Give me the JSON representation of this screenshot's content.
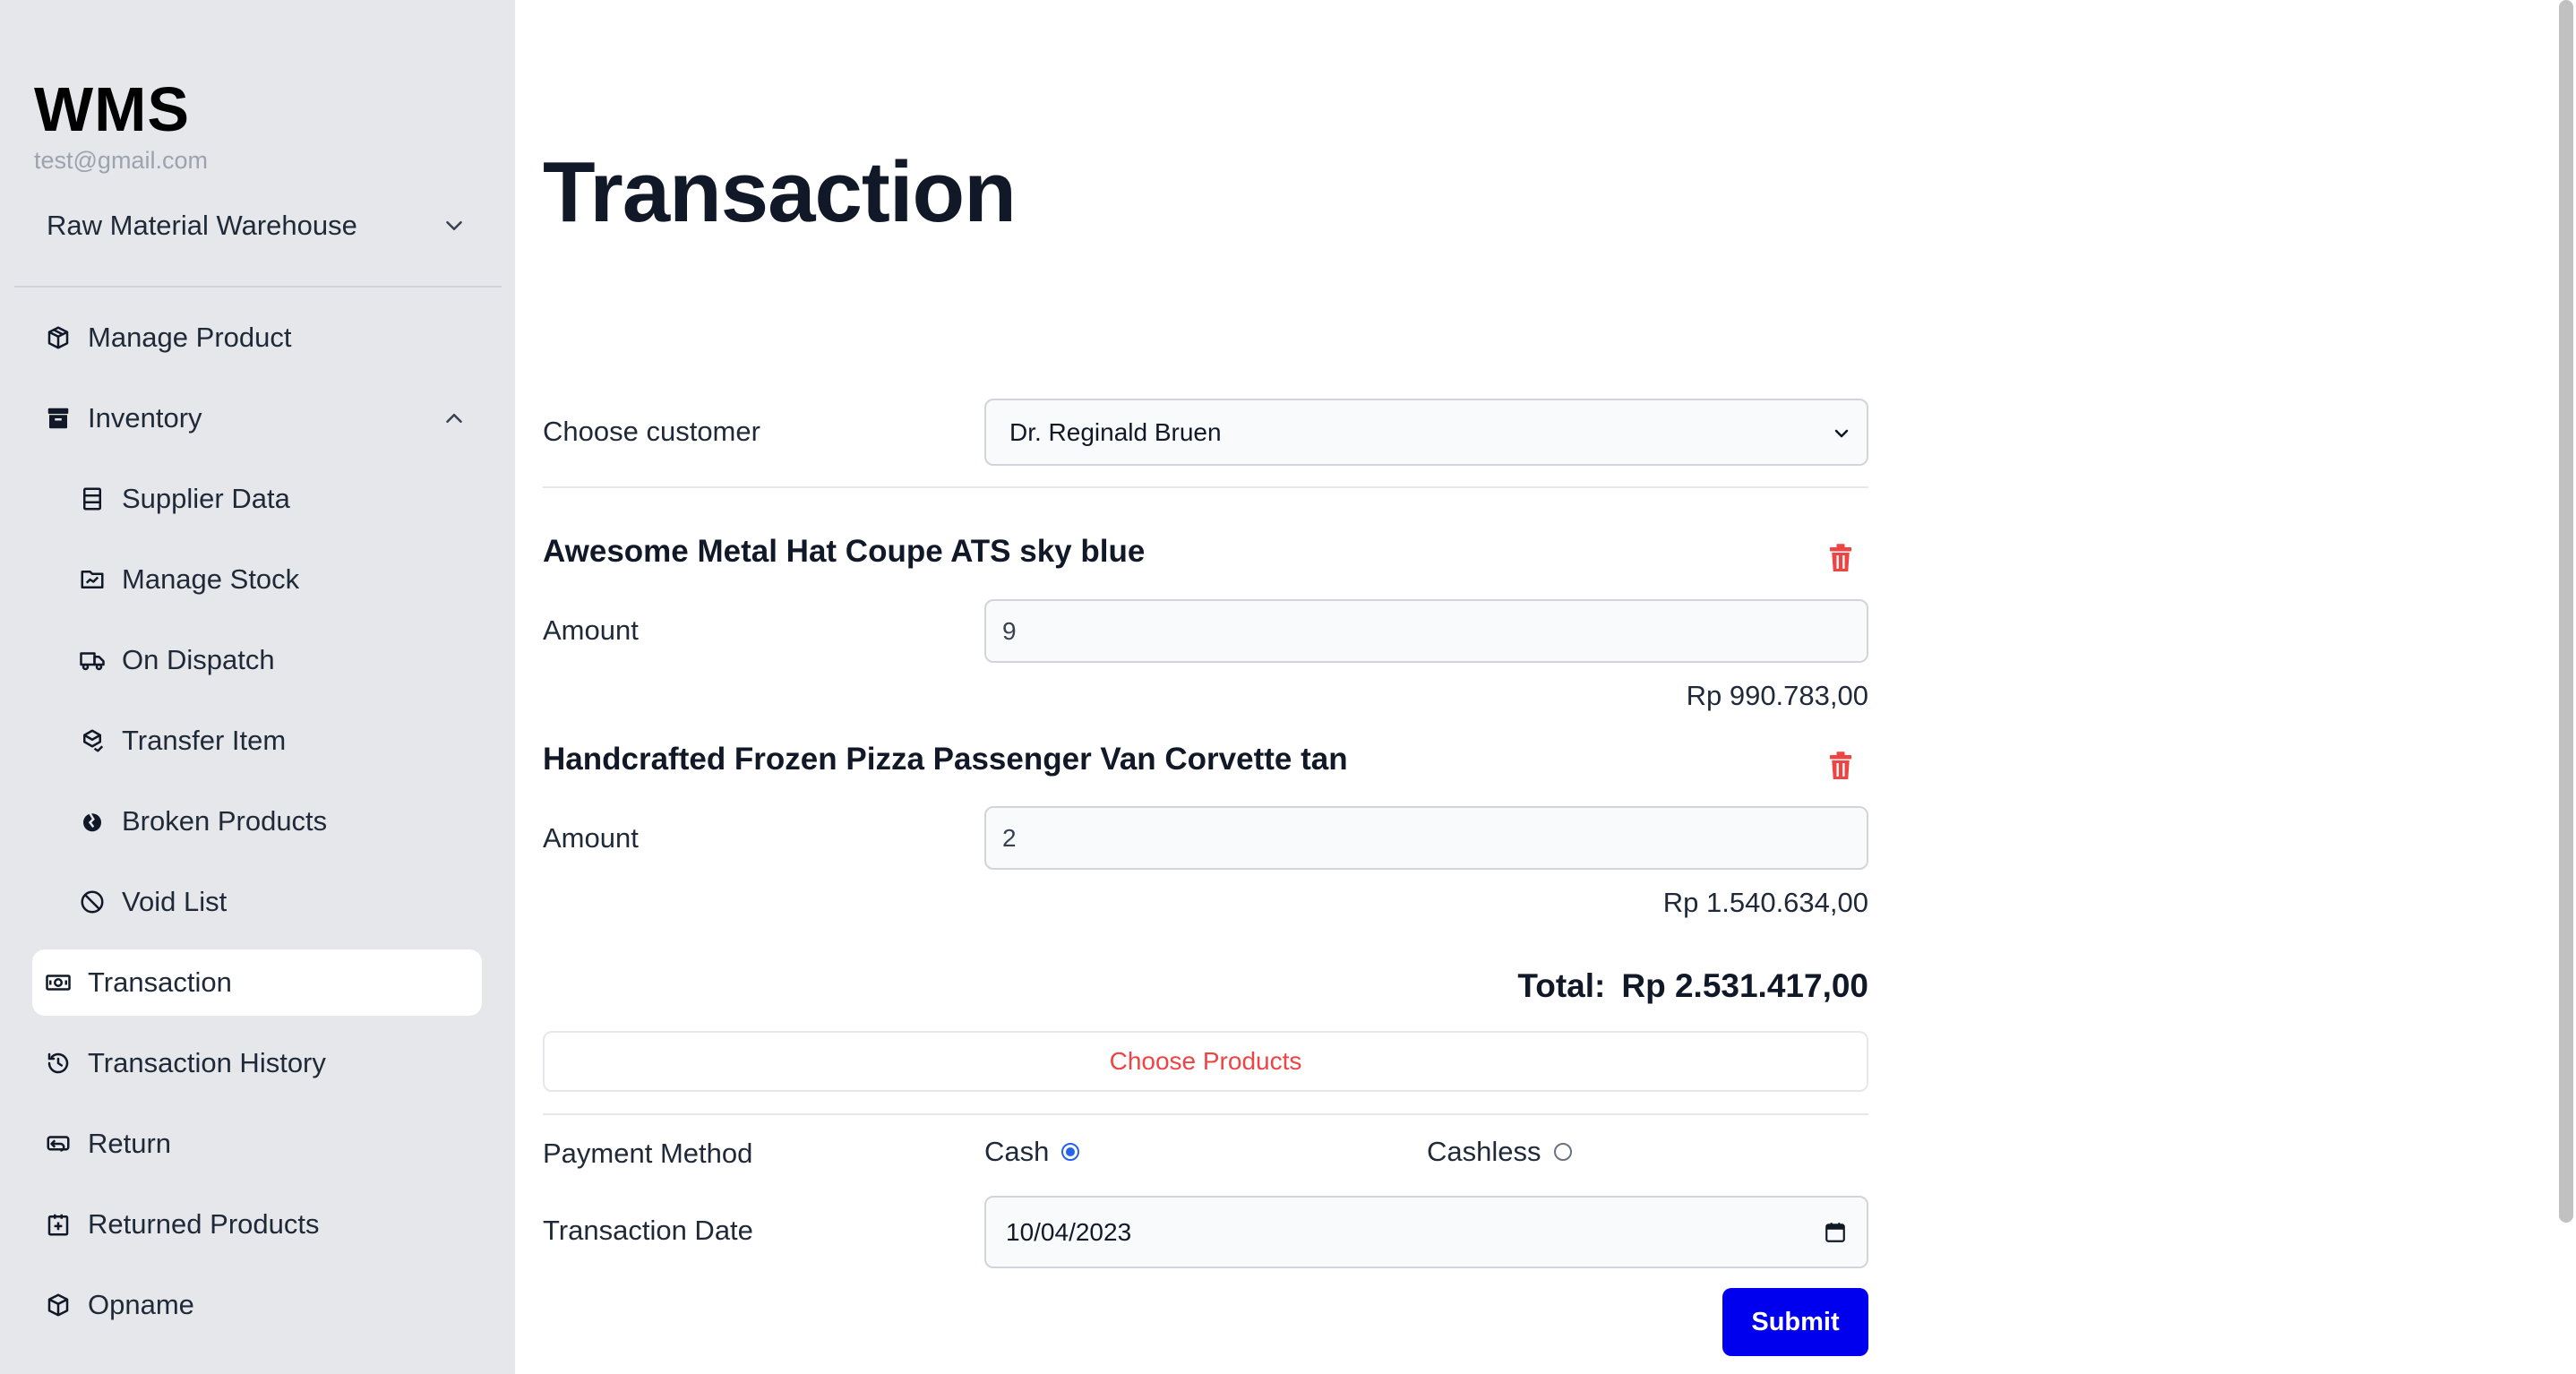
{
  "sidebar": {
    "brand": "WMS",
    "email": "test@gmail.com",
    "warehouse": "Raw Material Warehouse",
    "items": [
      {
        "label": "Manage Product",
        "icon": "product-box-icon"
      },
      {
        "label": "Inventory",
        "icon": "archive-icon",
        "expanded": true
      },
      {
        "label": "Supplier Data",
        "icon": "list-icon"
      },
      {
        "label": "Manage Stock",
        "icon": "stock-icon"
      },
      {
        "label": "On Dispatch",
        "icon": "truck-icon"
      },
      {
        "label": "Transfer Item",
        "icon": "transfer-icon"
      },
      {
        "label": "Broken Products",
        "icon": "broken-icon"
      },
      {
        "label": "Void List",
        "icon": "ban-icon"
      },
      {
        "label": "Transaction",
        "icon": "money-icon",
        "active": true
      },
      {
        "label": "Transaction History",
        "icon": "history-icon"
      },
      {
        "label": "Return",
        "icon": "return-icon"
      },
      {
        "label": "Returned Products",
        "icon": "returned-box-icon"
      },
      {
        "label": "Opname",
        "icon": "cube-icon"
      }
    ]
  },
  "main": {
    "title": "Transaction",
    "customer_label": "Choose customer",
    "customer_value": "Dr. Reginald Bruen",
    "products": [
      {
        "name": "Awesome Metal Hat Coupe ATS sky blue",
        "amount_label": "Amount",
        "amount": "9",
        "price": "Rp 990.783,00"
      },
      {
        "name": "Handcrafted Frozen Pizza Passenger Van Corvette tan",
        "amount_label": "Amount",
        "amount": "2",
        "price": "Rp 1.540.634,00"
      }
    ],
    "total_label": "Total:",
    "total_value": "Rp 2.531.417,00",
    "choose_products": "Choose Products",
    "payment_label": "Payment Method",
    "payment_cash": "Cash",
    "payment_cashless": "Cashless",
    "payment_selected": "Cash",
    "date_label": "Transaction Date",
    "date_value": "10/04/2023",
    "submit": "Submit"
  },
  "colors": {
    "sidebar_bg": "#e5e7eb",
    "accent": "#0000ee",
    "danger": "#ef4444",
    "radio": "#2563eb"
  }
}
